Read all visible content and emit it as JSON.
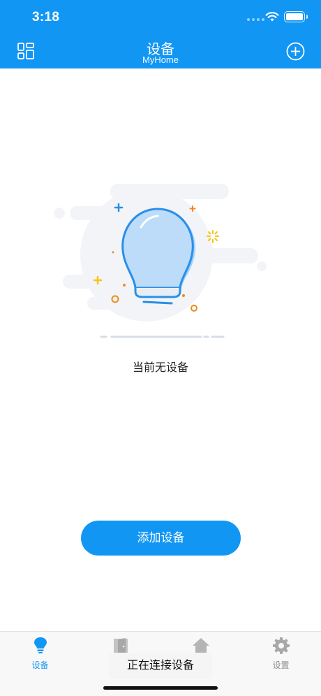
{
  "status_bar": {
    "time": "3:18"
  },
  "nav": {
    "title": "设备",
    "subtitle": "MyHome"
  },
  "empty_state": {
    "message": "当前无设备"
  },
  "add_device_button": {
    "label": "添加设备"
  },
  "tabs": [
    {
      "label": "设备",
      "icon": "bulb-icon",
      "active": true
    },
    {
      "label": "",
      "icon": "door-icon",
      "active": false
    },
    {
      "label": "",
      "icon": "house-icon",
      "active": false
    },
    {
      "label": "设置",
      "icon": "gear-icon",
      "active": false
    }
  ],
  "toast": {
    "message": "正在连接设备"
  },
  "colors": {
    "primary": "#1296f4",
    "tab_inactive": "#8a8a8a"
  }
}
